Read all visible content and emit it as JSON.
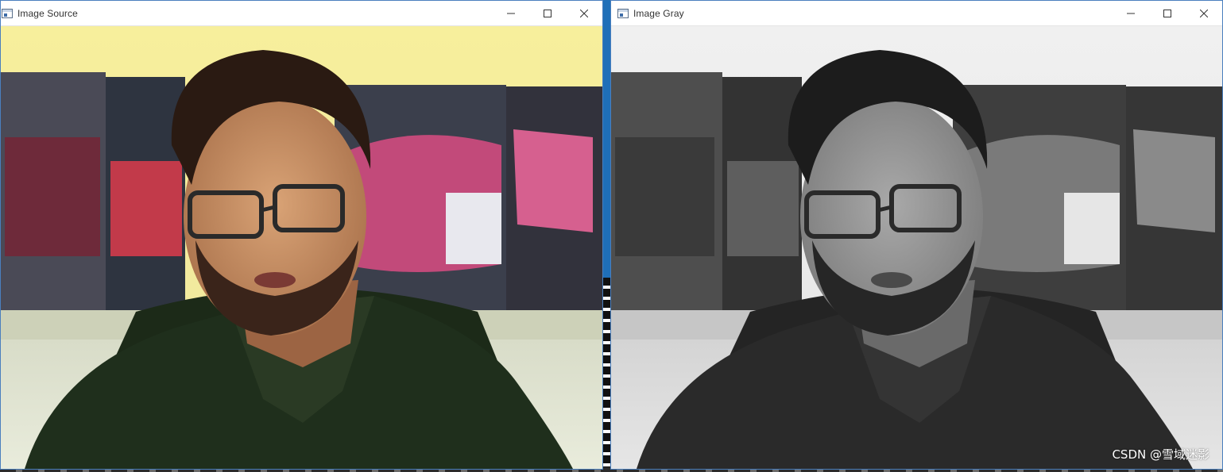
{
  "windows": [
    {
      "title": "Image Source",
      "controls": {
        "minimize": "minimize",
        "maximize": "maximize",
        "close": "close"
      },
      "mode": "color"
    },
    {
      "title": "Image Gray",
      "controls": {
        "minimize": "minimize",
        "maximize": "maximize",
        "close": "close"
      },
      "mode": "grayscale"
    }
  ],
  "watermark": "CSDN @雪域迷影",
  "colors": {
    "desktop": "#1f6fb8",
    "window_border": "#4a7fbe",
    "titlebar": "#ffffff"
  }
}
